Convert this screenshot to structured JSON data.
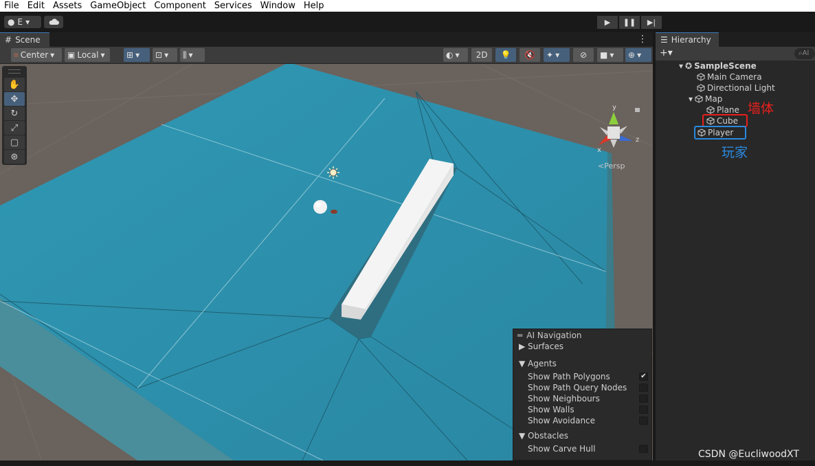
{
  "menubar": [
    "File",
    "Edit",
    "Assets",
    "GameObject",
    "Component",
    "Services",
    "Window",
    "Help"
  ],
  "toolbar": {
    "account_label": "E"
  },
  "scene_tab": {
    "label": "Scene"
  },
  "scene_toolbar": {
    "pivot": "Center",
    "space": "Local",
    "mode_2d": "2D"
  },
  "viewport": {
    "persp_label": "<Persp",
    "gizmo_axes": [
      "y",
      "x",
      "z"
    ]
  },
  "ai_navigation": {
    "title": "AI Navigation",
    "surfaces": "Surfaces",
    "agents": "Agents",
    "agent_options": [
      {
        "label": "Show Path Polygons",
        "checked": true
      },
      {
        "label": "Show Path Query Nodes",
        "checked": false
      },
      {
        "label": "Show Neighbours",
        "checked": false
      },
      {
        "label": "Show Walls",
        "checked": false
      },
      {
        "label": "Show Avoidance",
        "checked": false
      }
    ],
    "obstacles": "Obstacles",
    "obstacle_options": [
      {
        "label": "Show Carve Hull",
        "checked": false
      }
    ]
  },
  "hierarchy": {
    "tab": "Hierarchy",
    "search_placeholder": "Al",
    "scene": "SampleScene",
    "items": [
      "Main Camera",
      "Directional Light",
      "Map",
      "Plane",
      "Cube",
      "Player"
    ],
    "annotations": {
      "wall": "墙体",
      "player": "玩家",
      "wall_color": "#e8201c",
      "player_color": "#2a8ae0"
    }
  },
  "watermark": "CSDN @EucliwoodXT",
  "colors": {
    "navmesh": "#2f9ab8",
    "ground": "#6a615c",
    "selection": "#46607c"
  }
}
